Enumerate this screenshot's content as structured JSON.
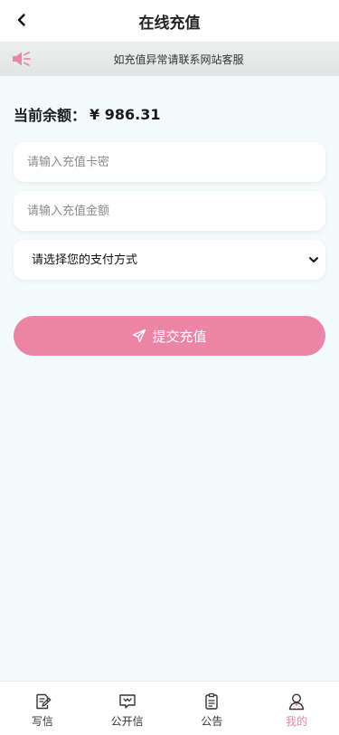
{
  "header": {
    "title": "在线充值",
    "back_icon": "chevron-left-icon"
  },
  "notice": {
    "icon": "speaker-icon",
    "text": "如充值异常请联系网站客服"
  },
  "balance": {
    "label": "当前余额：",
    "amount": "¥ 986.31"
  },
  "form": {
    "card_placeholder": "请输入充值卡密",
    "amount_placeholder": "请输入充值金额",
    "payment_selected": "请选择您的支付方式",
    "submit_label": "提交充值",
    "submit_icon": "send-icon"
  },
  "tabbar": {
    "active_color": "#ec84a6",
    "items": [
      {
        "label": "写信",
        "icon": "write-icon"
      },
      {
        "label": "公开信",
        "icon": "message-icon"
      },
      {
        "label": "公告",
        "icon": "clipboard-icon"
      },
      {
        "label": "我的",
        "icon": "user-icon"
      }
    ]
  },
  "colors": {
    "accent": "#ec84a6",
    "background": "#f5fbfb"
  }
}
